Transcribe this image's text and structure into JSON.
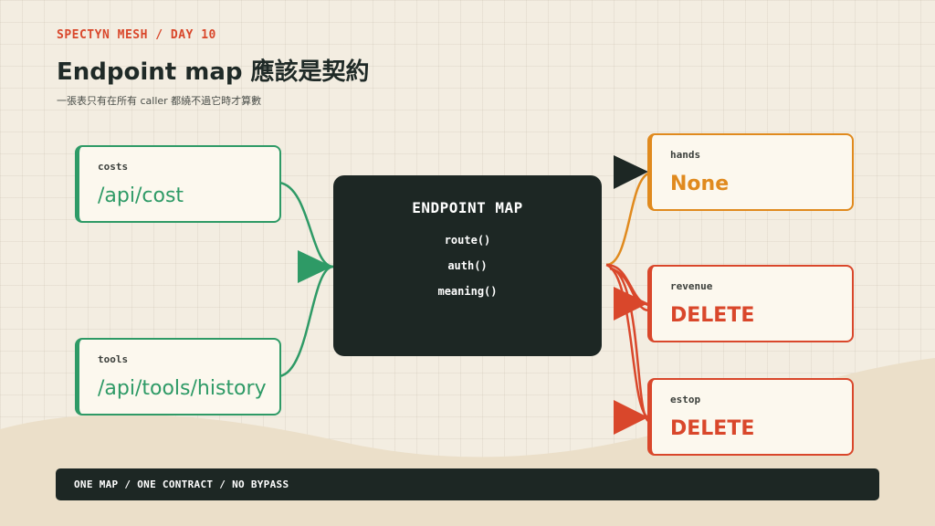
{
  "header": {
    "eyebrow": "SPECTYN MESH / DAY 10",
    "title": "Endpoint map 應該是契約",
    "subtitle": "一張表只有在所有 caller 都繞不過它時才算數"
  },
  "sources": [
    {
      "label": "costs",
      "path": "/api/cost"
    },
    {
      "label": "tools",
      "path": "/api/tools/history"
    }
  ],
  "center": {
    "title": "ENDPOINT MAP",
    "lines": [
      "route()",
      "auth()",
      "meaning()"
    ]
  },
  "targets": [
    {
      "label": "hands",
      "value": "None",
      "status": "none"
    },
    {
      "label": "revenue",
      "value": "DELETE",
      "status": "delete"
    },
    {
      "label": "estop",
      "value": "DELETE",
      "status": "delete"
    }
  ],
  "footer": {
    "text": "ONE MAP / ONE CONTRACT / NO BYPASS"
  },
  "colors": {
    "background": "#f3ede1",
    "wave": "#ebdfc9",
    "accent_red": "#d9472b",
    "green": "#2e9a66",
    "orange": "#e08a1e",
    "dark": "#1d2724",
    "black_arrow": "#1d2724"
  },
  "icons": {
    "source_arrow": "triangle-right-icon",
    "target_arrows": "triangle-right-icon"
  }
}
